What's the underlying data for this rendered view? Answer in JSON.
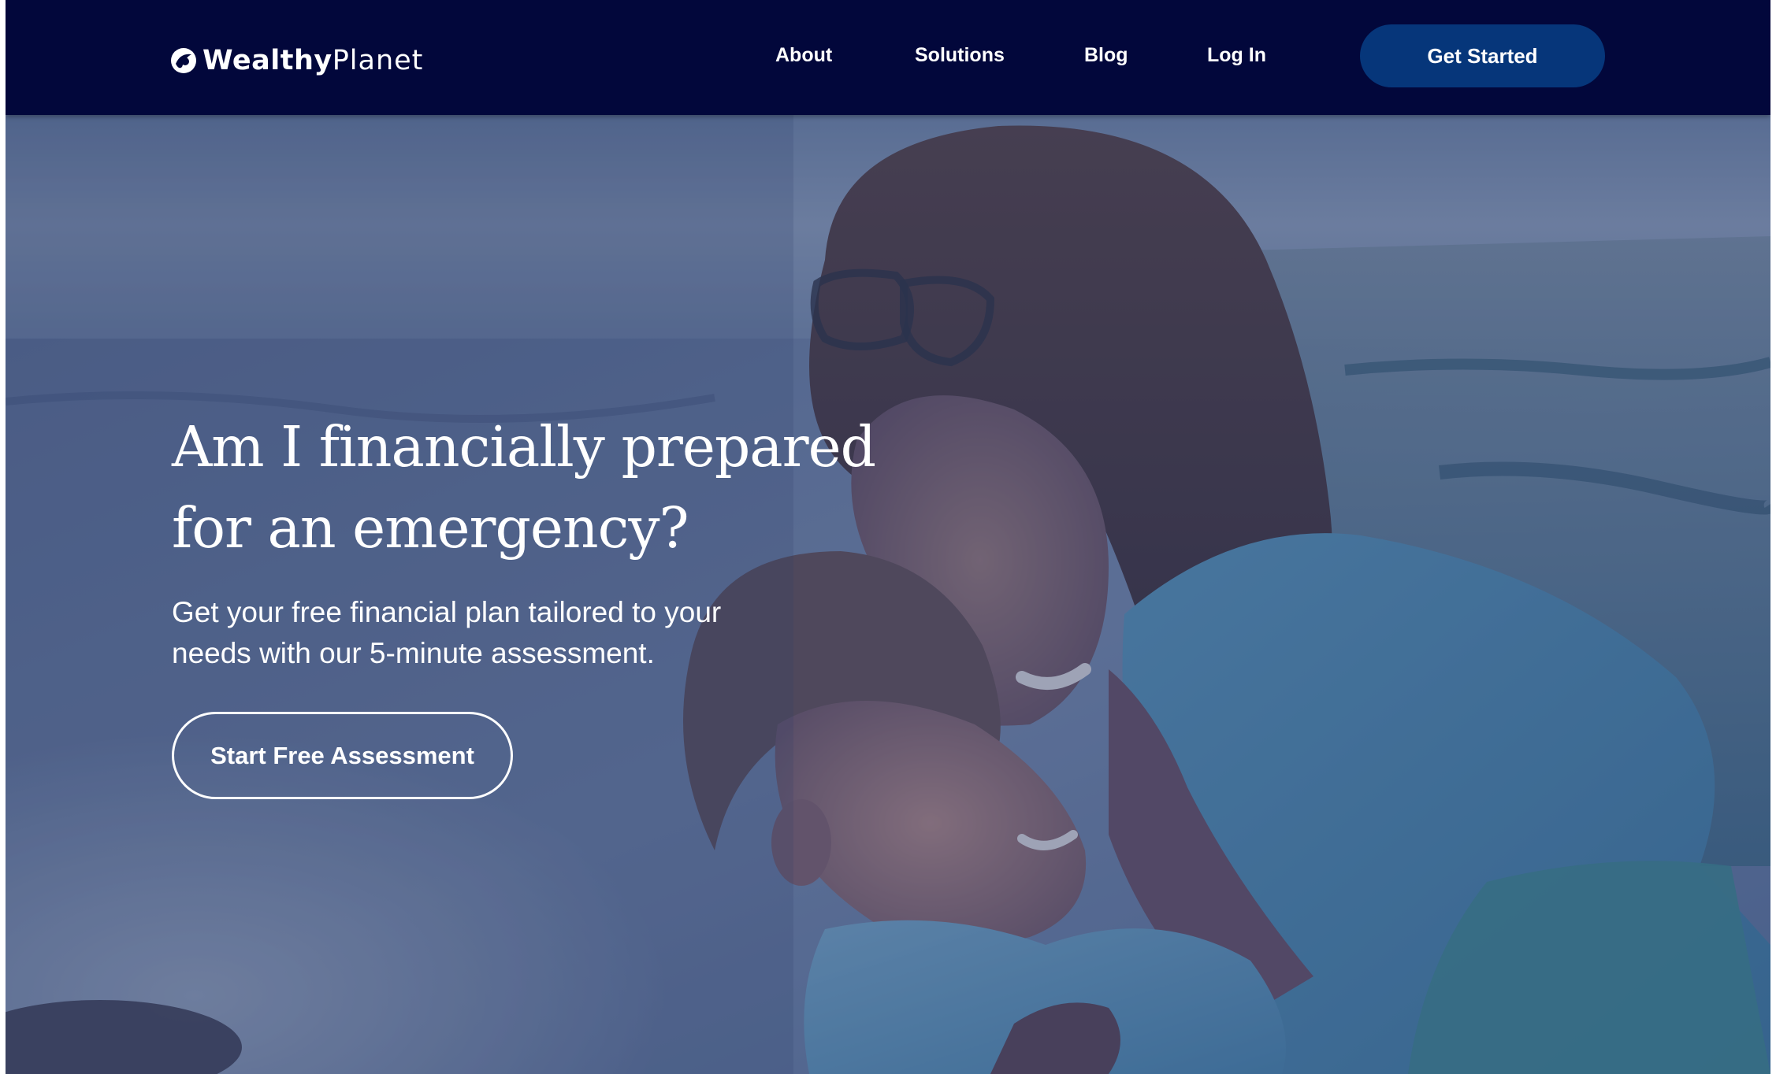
{
  "brand": {
    "name_bold": "Wealthy",
    "name_light": "Planet"
  },
  "nav": {
    "links": [
      {
        "label": "About"
      },
      {
        "label": "Solutions"
      },
      {
        "label": "Blog"
      },
      {
        "label": "Log In"
      }
    ],
    "cta_label": "Get Started"
  },
  "hero": {
    "headline_line1": "Am I financially prepared",
    "headline_line2": "for an emergency?",
    "subhead_line1": "Get your free financial plan tailored to your",
    "subhead_line2": "needs with our 5-minute assessment.",
    "button_label": "Start Free Assessment",
    "image_subject": "mother-and-child-hugging-at-beach-photo"
  },
  "colors": {
    "nav_background": "#02073b",
    "cta_background": "#06367a",
    "text": "#ffffff",
    "hero_overlay": "#3b4d74"
  }
}
